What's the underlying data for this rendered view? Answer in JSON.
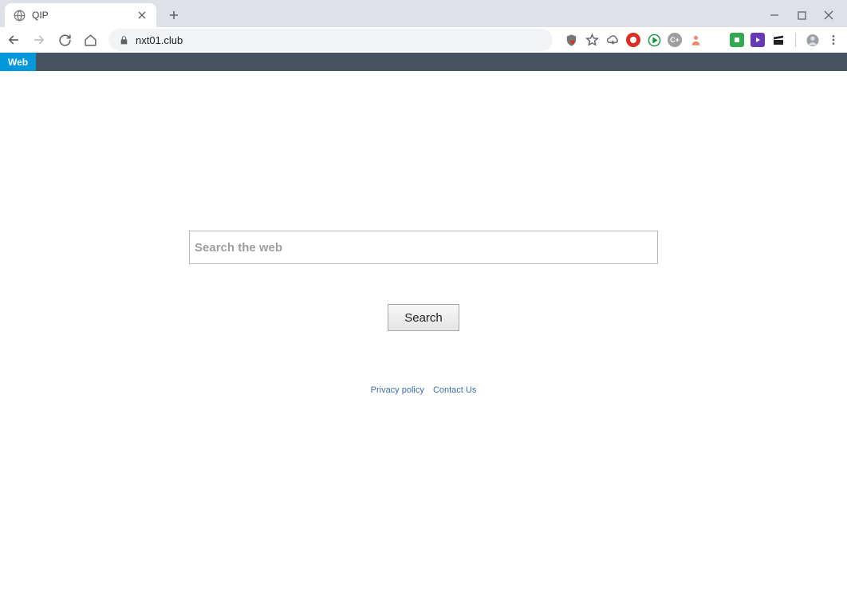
{
  "browser": {
    "tab_title": "QIP",
    "url": "nxt01.club"
  },
  "page": {
    "nav_tab": "Web",
    "search_placeholder": "Search the web",
    "search_button": "Search",
    "privacy_link": "Privacy policy",
    "contact_link": "Contact Us"
  }
}
